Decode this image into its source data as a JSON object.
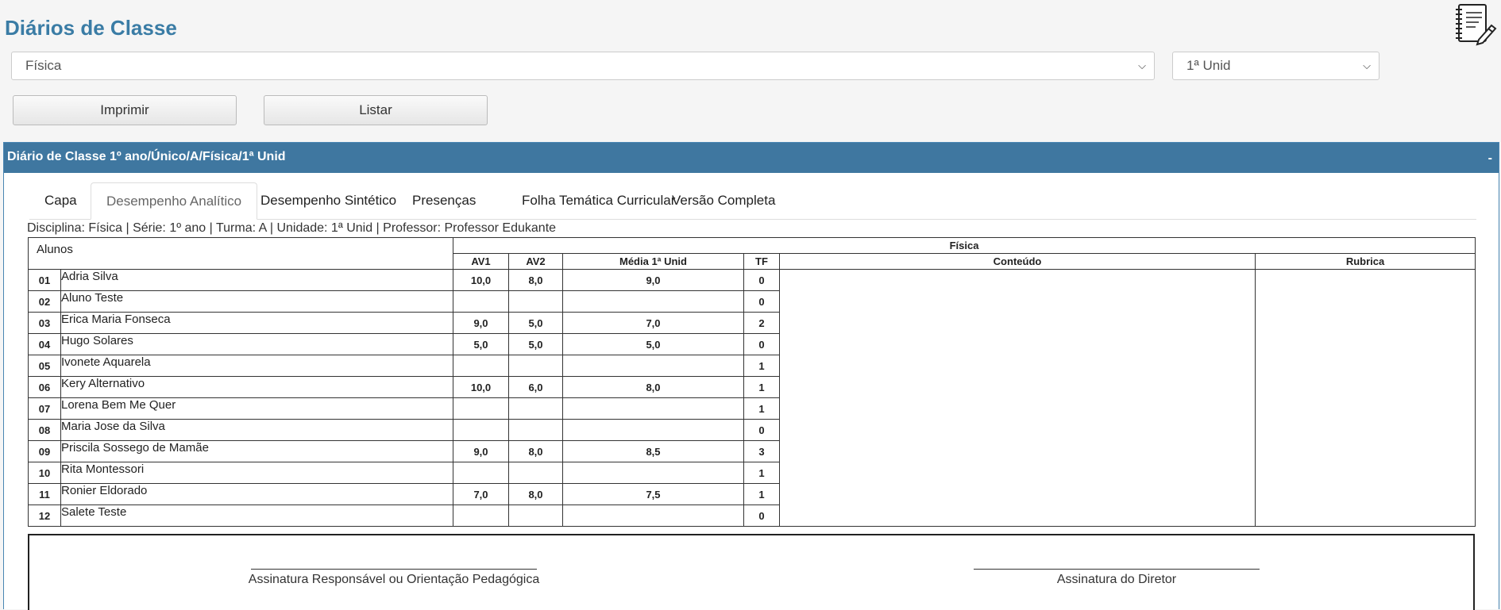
{
  "header": {
    "title": "Diários de Classe"
  },
  "filters": {
    "subject": "Física",
    "unit": "1ª Unid"
  },
  "actions": {
    "print_label": "Imprimir",
    "list_label": "Listar"
  },
  "panel": {
    "title": "Diário de Classe 1º ano/Único/A/Física/1ª Unid",
    "collapse_label": "-"
  },
  "tabs": [
    {
      "label": "Capa",
      "active": false
    },
    {
      "label": "Desempenho Analítico",
      "active": true
    },
    {
      "label": "Desempenho Sintético",
      "active": false
    },
    {
      "label": "Presenças",
      "active": false
    },
    {
      "label": "Folha Temática Curricular",
      "active": false
    },
    {
      "label": "Versão Completa",
      "active": false
    }
  ],
  "info": "Disciplina: Física | Série: 1º ano | Turma: A | Unidade: 1ª Unid | Professor: Professor Edukante",
  "table": {
    "students_header": "Alunos",
    "subject_header": "Física",
    "columns": [
      "AV1",
      "AV2",
      "Média 1ª Unid",
      "TF",
      "Conteúdo",
      "Rubrica"
    ],
    "rows": [
      {
        "num": "01",
        "name": "Adria Silva",
        "av1": "10,0",
        "av2": "8,0",
        "media": "9,0",
        "tf": "0"
      },
      {
        "num": "02",
        "name": "Aluno Teste",
        "av1": "",
        "av2": "",
        "media": "",
        "tf": "0"
      },
      {
        "num": "03",
        "name": "Erica Maria Fonseca",
        "av1": "9,0",
        "av2": "5,0",
        "media": "7,0",
        "tf": "2"
      },
      {
        "num": "04",
        "name": "Hugo Solares",
        "av1": "5,0",
        "av2": "5,0",
        "media": "5,0",
        "tf": "0"
      },
      {
        "num": "05",
        "name": "Ivonete Aquarela",
        "av1": "",
        "av2": "",
        "media": "",
        "tf": "1"
      },
      {
        "num": "06",
        "name": "Kery Alternativo",
        "av1": "10,0",
        "av2": "6,0",
        "media": "8,0",
        "tf": "1"
      },
      {
        "num": "07",
        "name": "Lorena Bem Me Quer",
        "av1": "",
        "av2": "",
        "media": "",
        "tf": "1"
      },
      {
        "num": "08",
        "name": "Maria Jose da Silva",
        "av1": "",
        "av2": "",
        "media": "",
        "tf": "0"
      },
      {
        "num": "09",
        "name": "Priscila Sossego de Mamãe",
        "av1": "9,0",
        "av2": "8,0",
        "media": "8,5",
        "tf": "3"
      },
      {
        "num": "10",
        "name": "Rita Montessori",
        "av1": "",
        "av2": "",
        "media": "",
        "tf": "1"
      },
      {
        "num": "11",
        "name": "Ronier Eldorado",
        "av1": "7,0",
        "av2": "8,0",
        "media": "7,5",
        "tf": "1"
      },
      {
        "num": "12",
        "name": "Salete Teste",
        "av1": "",
        "av2": "",
        "media": "",
        "tf": "0"
      }
    ]
  },
  "signatures": {
    "left": "Assinatura Responsável ou Orientação Pedagógica",
    "right": "Assinatura do Diretor"
  },
  "icons": {
    "header_icon": "notebook-pen-icon",
    "dropdown_icon": "chevron-down-icon"
  }
}
